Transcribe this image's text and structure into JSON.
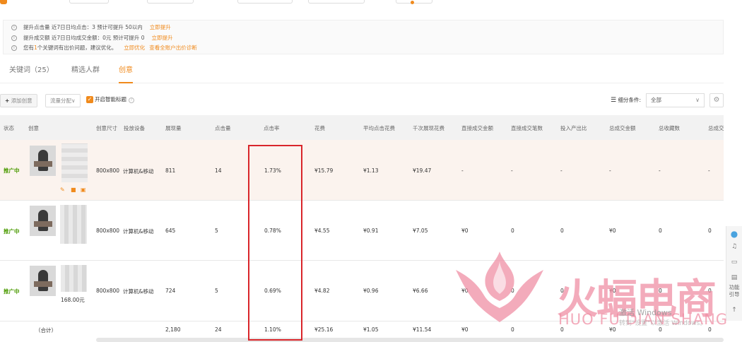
{
  "tips": [
    {
      "text": "提升点击量 近7日日均点击：3  预计可提升 50以内",
      "link": "立即提升"
    },
    {
      "text": "提升成交额 近7日日均成交金额：0元  预计可提升 0",
      "link": "立即提升"
    },
    {
      "text_prefix": "您有",
      "count": "1",
      "text_suffix": "个关键词有出价问题，建议优化。",
      "link": "立即优化",
      "link2": "查看全账户出价诊断"
    }
  ],
  "tabs": [
    {
      "label": "关键词（25）",
      "active": false
    },
    {
      "label": "精选人群",
      "active": false
    },
    {
      "label": "创意",
      "active": true
    }
  ],
  "toolbar": {
    "add_label": "添加创意",
    "traffic_label": "流量分配",
    "smart_title_label": "开启智能标题",
    "filter_label": "细分条件:",
    "filter_value": "全部"
  },
  "columns": [
    "状态",
    "创意",
    "创意尺寸",
    "投放设备",
    "展现量",
    "点击量",
    "点击率",
    "花费",
    "平均点击花费",
    "千次展现花费",
    "直接成交金额",
    "直接成交笔数",
    "投入产出比",
    "总成交金额",
    "总收藏数",
    "总成交"
  ],
  "rows": [
    {
      "status": "推广中",
      "size": "800x800",
      "device": "计算机&移动",
      "impressions": "811",
      "clicks": "14",
      "ctr": "1.73%",
      "cost": "¥15.79",
      "cpc": "¥1.13",
      "cpm": "¥19.47",
      "direct_amount": "-",
      "direct_count": "-",
      "roi": "-",
      "total_amount": "-",
      "total_fav": "-",
      "total_deal": "-"
    },
    {
      "status": "推广中",
      "size": "800x800",
      "device": "计算机&移动",
      "impressions": "645",
      "clicks": "5",
      "ctr": "0.78%",
      "cost": "¥4.55",
      "cpc": "¥0.91",
      "cpm": "¥7.05",
      "direct_amount": "¥0",
      "direct_count": "0",
      "roi": "0",
      "total_amount": "¥0",
      "total_fav": "0",
      "total_deal": "0"
    },
    {
      "status": "推广中",
      "size": "800x800",
      "device": "计算机&移动",
      "impressions": "724",
      "clicks": "5",
      "ctr": "0.69%",
      "cost": "¥4.82",
      "cpc": "¥0.96",
      "cpm": "¥6.66",
      "direct_amount": "¥0",
      "direct_count": "0",
      "roi": "0",
      "total_amount": "¥0",
      "total_fav": "0",
      "total_deal": "0",
      "price_label": "168.00元"
    }
  ],
  "summary": {
    "label": "（合计）",
    "impressions": "2,180",
    "clicks": "24",
    "ctr": "1.10%",
    "cost": "¥25.16",
    "cpc": "¥1.05",
    "cpm": "¥11.54",
    "direct_amount": "¥0",
    "direct_count": "0",
    "roi": "0",
    "total_amount": "¥0",
    "total_fav": "0",
    "total_deal": "0"
  },
  "sidebar": {
    "guide_label": "功能引导"
  },
  "watermark": {
    "title": "火蝠电商",
    "subtitle": "HUO FU DIAN SHANG",
    "windows_line1": "激活 Windows",
    "windows_line2": "转到\"设置\"以激活 Windows。"
  },
  "colors": {
    "accent": "#f08a1c",
    "status_green": "#4a9a00",
    "highlight_red": "#d9252a",
    "watermark_pink": "#ef8fa5"
  }
}
